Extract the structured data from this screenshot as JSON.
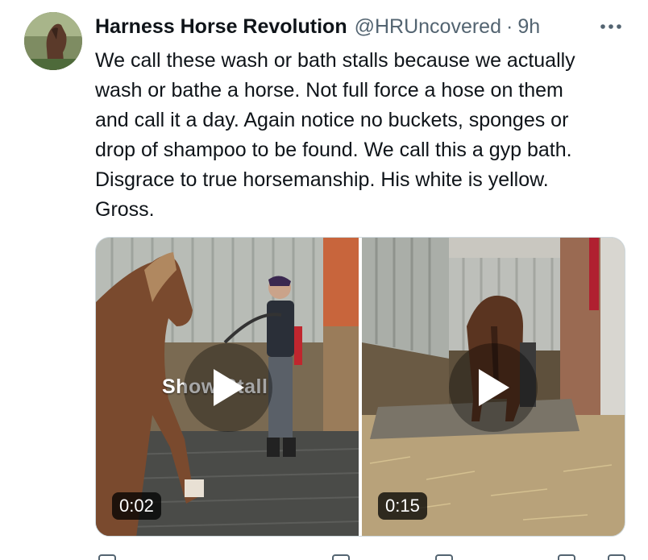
{
  "tweet": {
    "author": {
      "display_name": "Harness Horse Revolution",
      "handle": "@HRUncovered",
      "separator": "·",
      "time": "9h"
    },
    "more_icon": "more-horizontal-icon",
    "text_lines": [
      "We call these wash or bath stalls because we actually",
      "wash or bathe a horse. Not full force a hose on them",
      "and call it a day. Again notice no buckets, sponges or",
      "drop of shampoo to be found. We call this a gyp bath.",
      "Disgrace to true horsemanship. His white is yellow.",
      "Gross."
    ],
    "media": [
      {
        "overlay_text": "Show Stall",
        "duration": "0:02",
        "icon": "play-icon"
      },
      {
        "overlay_text": "",
        "duration": "0:15",
        "icon": "play-icon"
      }
    ],
    "colors": {
      "text": "#0f1419",
      "secondary": "#536471",
      "border": "#cfd9de"
    }
  }
}
